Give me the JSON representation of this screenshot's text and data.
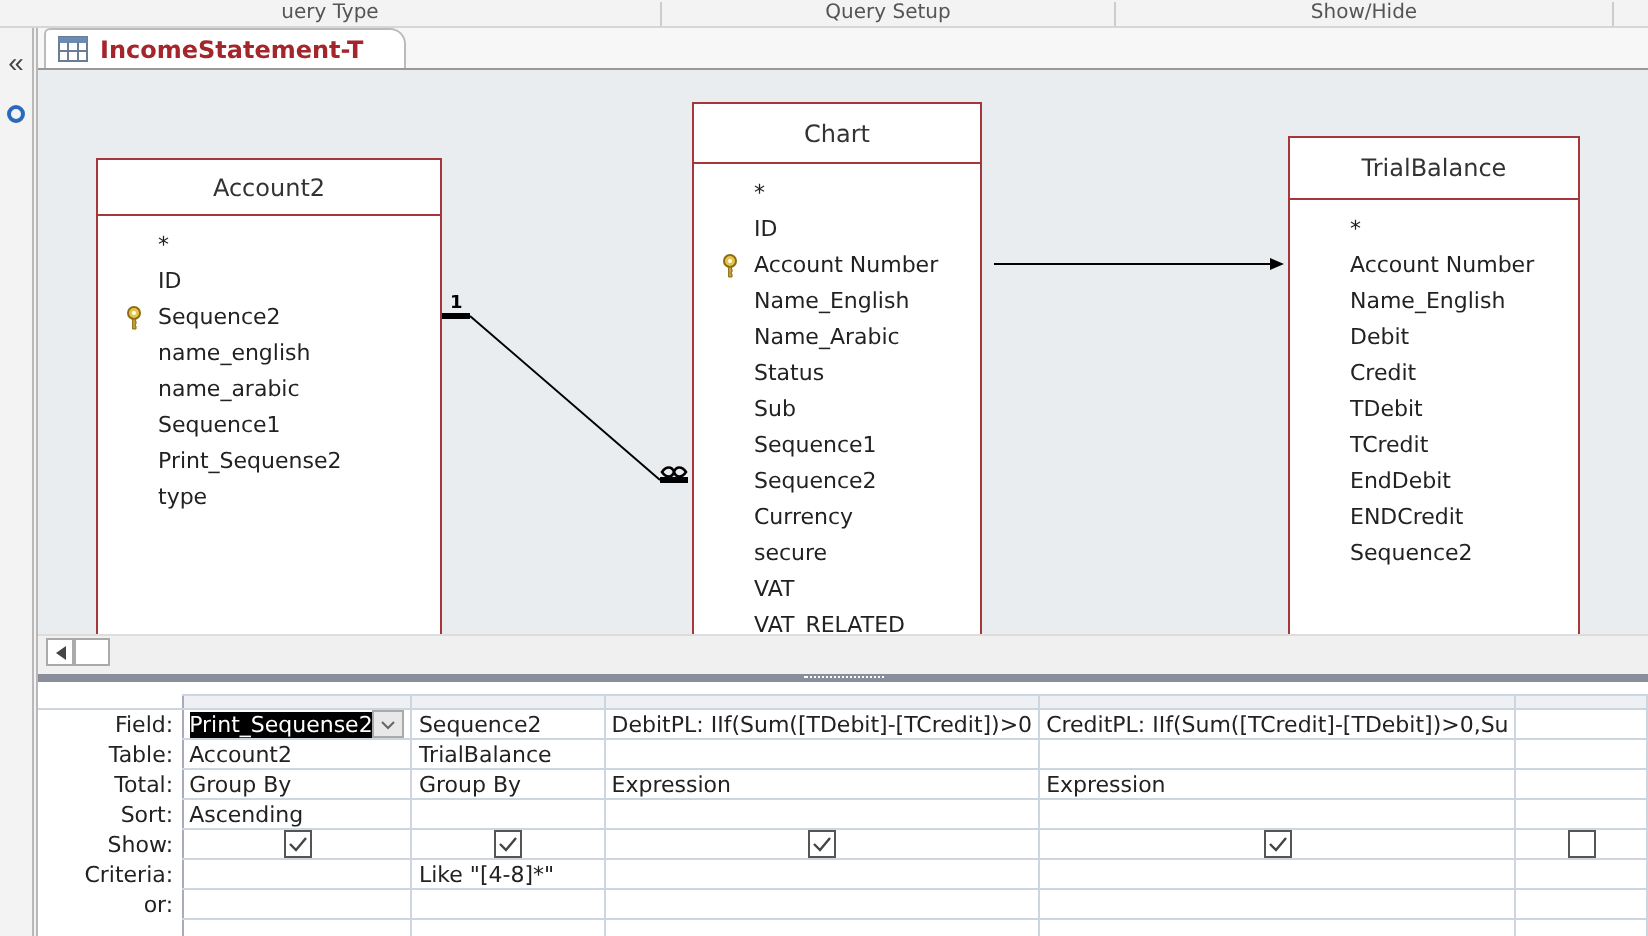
{
  "ribbon_groups": [
    "uery Type",
    "Query Setup",
    "Show/Hide"
  ],
  "nav_pane": {
    "collapse": "«"
  },
  "tab": {
    "title": "IncomeStatement-T",
    "selected": true
  },
  "tables": [
    {
      "title": "Account2",
      "fields": [
        {
          "name": "*",
          "key": false
        },
        {
          "name": "ID",
          "key": false
        },
        {
          "name": "Sequence2",
          "key": true
        },
        {
          "name": "name_english",
          "key": false
        },
        {
          "name": "name_arabic",
          "key": false
        },
        {
          "name": "Sequence1",
          "key": false
        },
        {
          "name": "Print_Sequense2",
          "key": false
        },
        {
          "name": "type",
          "key": false
        }
      ]
    },
    {
      "title": "Chart",
      "fields": [
        {
          "name": "*",
          "key": false
        },
        {
          "name": "ID",
          "key": false
        },
        {
          "name": "Account Number",
          "key": true
        },
        {
          "name": "Name_English",
          "key": false
        },
        {
          "name": "Name_Arabic",
          "key": false
        },
        {
          "name": "Status",
          "key": false
        },
        {
          "name": "Sub",
          "key": false
        },
        {
          "name": "Sequence1",
          "key": false
        },
        {
          "name": "Sequence2",
          "key": false
        },
        {
          "name": "Currency",
          "key": false
        },
        {
          "name": "secure",
          "key": false
        },
        {
          "name": "VAT",
          "key": false
        },
        {
          "name": "VAT_RELATED",
          "key": false
        }
      ]
    },
    {
      "title": "TrialBalance",
      "fields": [
        {
          "name": "*",
          "key": false
        },
        {
          "name": "Account Number",
          "key": false
        },
        {
          "name": "Name_English",
          "key": false
        },
        {
          "name": "Debit",
          "key": false
        },
        {
          "name": "Credit",
          "key": false
        },
        {
          "name": "TDebit",
          "key": false
        },
        {
          "name": "TCredit",
          "key": false
        },
        {
          "name": "EndDebit",
          "key": false
        },
        {
          "name": "ENDCredit",
          "key": false
        },
        {
          "name": "Sequence2",
          "key": false
        }
      ]
    }
  ],
  "relationships": [
    {
      "kind": "enforced",
      "one_label": "1"
    },
    {
      "kind": "outer_join"
    }
  ],
  "grid": {
    "row_labels": [
      "Field:",
      "Table:",
      "Total:",
      "Sort:",
      "Show:",
      "Criteria:",
      "or:"
    ],
    "columns": [
      {
        "field": "Print_Sequense2",
        "table": "Account2",
        "total": "Group By",
        "sort": "Ascending",
        "show": true,
        "selected": true
      },
      {
        "field": "Sequence2",
        "table": "TrialBalance",
        "total": "Group By",
        "show": true,
        "criteria": "Like \"[4-8]*\"",
        "selected": false
      },
      {
        "field": "DebitPL: IIf(Sum([TDebit]-[TCredit])>0",
        "total": "Expression",
        "show": true,
        "selected": false
      },
      {
        "field": "CreditPL: IIf(Sum([TCredit]-[TDebit])>0,Su",
        "total": "Expression",
        "show": true,
        "selected": false
      },
      {
        "show": false,
        "selected": false
      }
    ]
  }
}
